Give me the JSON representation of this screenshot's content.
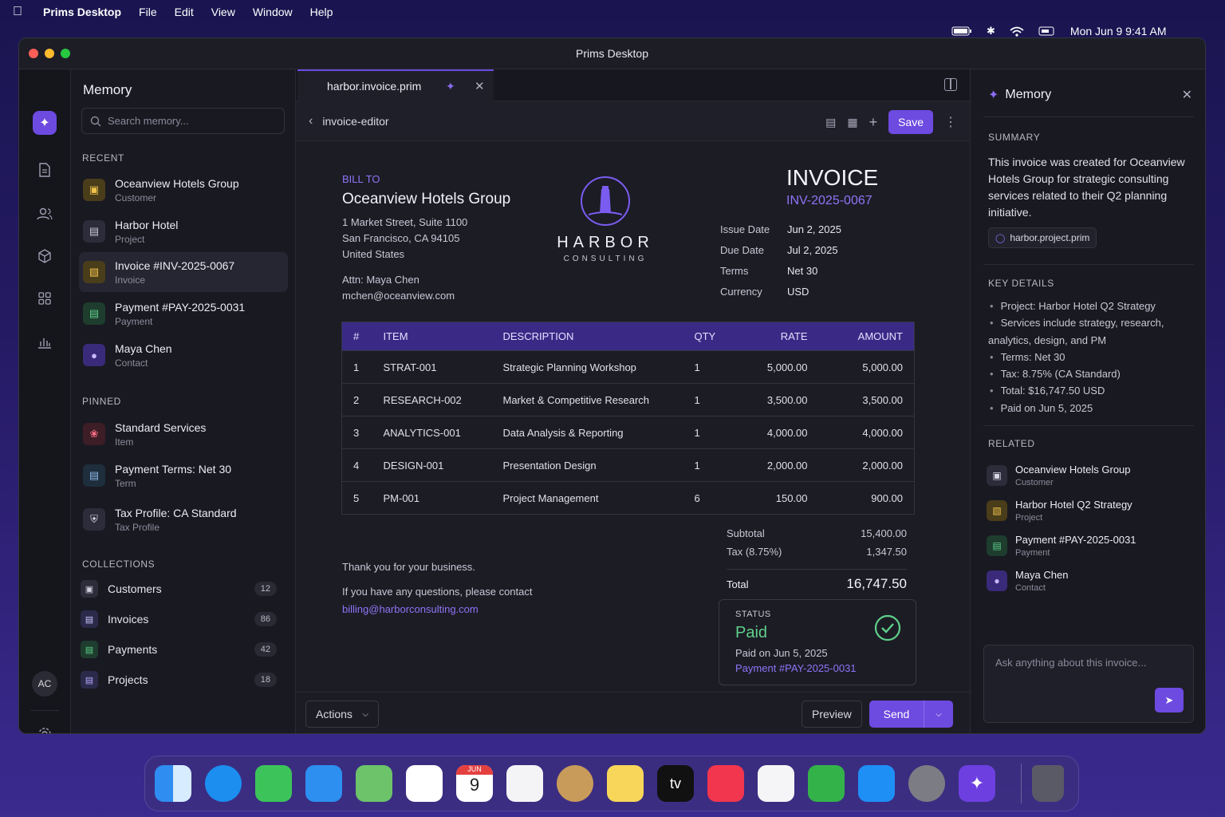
{
  "menubar": {
    "app": "Prims Desktop",
    "items": [
      "File",
      "Edit",
      "View",
      "Window",
      "Help"
    ],
    "clock": "Mon Jun 9  9:41 AM"
  },
  "window": {
    "title": "Prims Desktop"
  },
  "rail": {
    "user_initials": "AC"
  },
  "sidebar": {
    "title": "Memory",
    "search_placeholder": "Search memory...",
    "recent_label": "RECENT",
    "pinned_label": "PINNED",
    "collections_label": "COLLECTIONS",
    "recent": [
      {
        "title": "Oceanview Hotels Group",
        "type": "Customer"
      },
      {
        "title": "Harbor Hotel",
        "type": "Project"
      },
      {
        "title": "Invoice #INV-2025-0067",
        "type": "Invoice"
      },
      {
        "title": "Payment #PAY-2025-0031",
        "type": "Payment"
      },
      {
        "title": "Maya Chen",
        "type": "Contact"
      }
    ],
    "pinned": [
      {
        "title": "Standard Services",
        "type": "Item"
      },
      {
        "title": "Payment Terms: Net 30",
        "type": "Term"
      },
      {
        "title": "Tax Profile: CA Standard",
        "type": "Tax Profile"
      }
    ],
    "collections": [
      {
        "label": "Customers",
        "count": "12"
      },
      {
        "label": "Invoices",
        "count": "86"
      },
      {
        "label": "Payments",
        "count": "42"
      },
      {
        "label": "Projects",
        "count": "18"
      }
    ]
  },
  "editor": {
    "tab": "harbor.invoice.prim",
    "breadcrumb": "invoice-editor",
    "save": "Save"
  },
  "invoice": {
    "bill_to_label": "BILL TO",
    "customer": "Oceanview Hotels Group",
    "address": [
      "1 Market Street, Suite 1100",
      "San Francisco, CA 94105",
      "United States"
    ],
    "attn": "Attn: Maya Chen",
    "email": "mchen@oceanview.com",
    "logo_name": "HARBOR",
    "logo_sub": "CONSULTING",
    "heading": "INVOICE",
    "number": "INV-2025-0067",
    "meta": [
      {
        "k": "Issue Date",
        "v": "Jun 2, 2025"
      },
      {
        "k": "Due Date",
        "v": "Jul 2, 2025"
      },
      {
        "k": "Terms",
        "v": "Net 30"
      },
      {
        "k": "Currency",
        "v": "USD"
      }
    ],
    "columns": [
      "#",
      "ITEM",
      "DESCRIPTION",
      "QTY",
      "RATE",
      "AMOUNT"
    ],
    "rows": [
      [
        "1",
        "STRAT-001",
        "Strategic Planning Workshop",
        "1",
        "5,000.00",
        "5,000.00"
      ],
      [
        "2",
        "RESEARCH-002",
        "Market & Competitive Research",
        "1",
        "3,500.00",
        "3,500.00"
      ],
      [
        "3",
        "ANALYTICS-001",
        "Data Analysis & Reporting",
        "1",
        "4,000.00",
        "4,000.00"
      ],
      [
        "4",
        "DESIGN-001",
        "Presentation Design",
        "1",
        "2,000.00",
        "2,000.00"
      ],
      [
        "5",
        "PM-001",
        "Project Management",
        "6",
        "150.00",
        "900.00"
      ]
    ],
    "subtotal_label": "Subtotal",
    "subtotal": "15,400.00",
    "tax_label": "Tax (8.75%)",
    "tax": "1,347.50",
    "total_label": "Total",
    "total": "16,747.50",
    "thanks": "Thank you for your business.",
    "contact_line": "If you have any questions, please contact",
    "contact_email": "billing@harborconsulting.com",
    "status_label": "STATUS",
    "status": "Paid",
    "paid_on": "Paid on Jun 5, 2025",
    "payment_ref": "Payment #PAY-2025-0031"
  },
  "footer": {
    "actions": "Actions",
    "preview": "Preview",
    "send": "Send"
  },
  "panel": {
    "title": "Memory",
    "summary_label": "SUMMARY",
    "summary": "This invoice was created for Oceanview Hotels Group for strategic consulting services related to their Q2 planning initiative.",
    "chip": "harbor.project.prim",
    "key_details_label": "KEY DETAILS",
    "key_details": [
      "Project: Harbor Hotel Q2 Strategy",
      "Services include strategy, research, analytics, design, and PM",
      "Terms: Net 30",
      "Tax: 8.75% (CA Standard)",
      "Total: $16,747.50 USD",
      "Paid on Jun 5, 2025"
    ],
    "related_label": "RELATED",
    "related": [
      {
        "title": "Oceanview Hotels Group",
        "type": "Customer"
      },
      {
        "title": "Harbor Hotel Q2 Strategy",
        "type": "Project"
      },
      {
        "title": "Payment #PAY-2025-0031",
        "type": "Payment"
      },
      {
        "title": "Maya Chen",
        "type": "Contact"
      }
    ],
    "ask_placeholder": "Ask anything about this invoice..."
  },
  "dock": {
    "calendar_month": "JUN",
    "calendar_day": "9",
    "tv_label": "tv"
  }
}
